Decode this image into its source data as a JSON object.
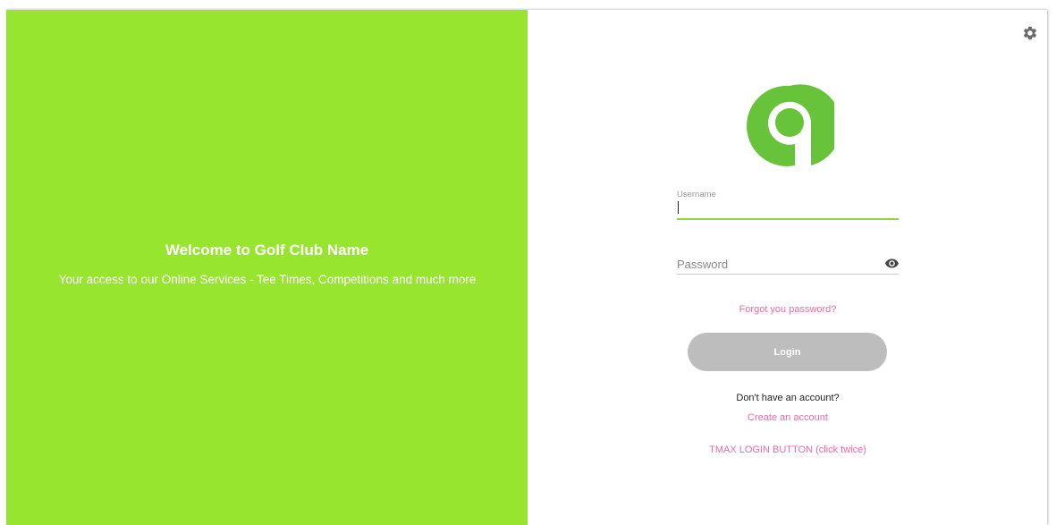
{
  "welcome": {
    "title": "Welcome to Golf Club Name",
    "subtitle": "Your access to our Online Services - Tee Times, Competitions and much more"
  },
  "icons": {
    "settings": "gear-icon",
    "logo": "logo-icon",
    "password_toggle": "eye-icon"
  },
  "login_form": {
    "username_label": "Username",
    "username_value": "",
    "password_placeholder": "Password",
    "password_value": "",
    "forgot_password": "Forgot you password?",
    "login_button": "Login",
    "no_account_text": "Don't have an account?",
    "create_account": "Create an account",
    "tmax_login": "TMAX LOGIN BUTTON (click twice)"
  },
  "colors": {
    "brand_green": "#97e52f",
    "logo_green": "#67c33a",
    "link_pink": "#ec6aa9",
    "button_disabled_gray": "#bdbdbd",
    "focus_underline": "#8fd63a"
  }
}
